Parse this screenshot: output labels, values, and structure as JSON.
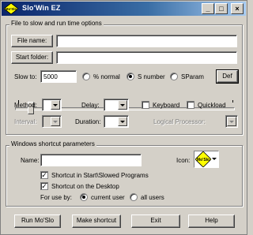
{
  "window": {
    "title": "Slo'Win EZ",
    "logo_text": "Mo'Slo"
  },
  "titlebar_buttons": [
    "_",
    "□",
    "×"
  ],
  "run_options": {
    "group_label": "File to slow and run time options",
    "file_name_button": "File name:",
    "file_name_value": "",
    "start_folder_button": "Start folder:",
    "start_folder_value": "",
    "slow_to_label": "Slow to:",
    "slow_to_value": "5000",
    "radio_percent": "% normal",
    "radio_snumber": "S number",
    "radio_sparam": "SParam",
    "selected_mode": "S number",
    "def_button": "Def",
    "slider_level": 0.06,
    "method_label": "Method:",
    "delay_label": "Delay:",
    "keyboard_label": "Keyboard",
    "keyboard_checked": false,
    "quickload_label": "Quickload",
    "quickload_checked": false,
    "interval_label": "Interval:",
    "duration_label": "Duration:",
    "logical_processor_label": "Logical Processor:"
  },
  "shortcut": {
    "group_label": "Windows shortcut parameters",
    "name_label": "Name:",
    "name_value": "",
    "icon_label": "Icon:",
    "icon_text": "Mo'Slo",
    "start_menu_label": "Shortcut in Start\\Slowed Programs",
    "start_menu_checked": true,
    "desktop_label": "Shortcut on the Desktop",
    "desktop_checked": true,
    "for_use_by_label": "For use by:",
    "current_user_label": "current user",
    "all_users_label": "all users",
    "selected_user": "current user"
  },
  "buttons": {
    "run": "Run Mo'Slo",
    "make_shortcut": "Make shortcut",
    "exit": "Exit",
    "help": "Help"
  },
  "colors": {
    "titlebar_start": "#0a246a",
    "titlebar_end": "#a6caf0",
    "face": "#d4d0c8",
    "logo_yellow": "#ffff00"
  }
}
